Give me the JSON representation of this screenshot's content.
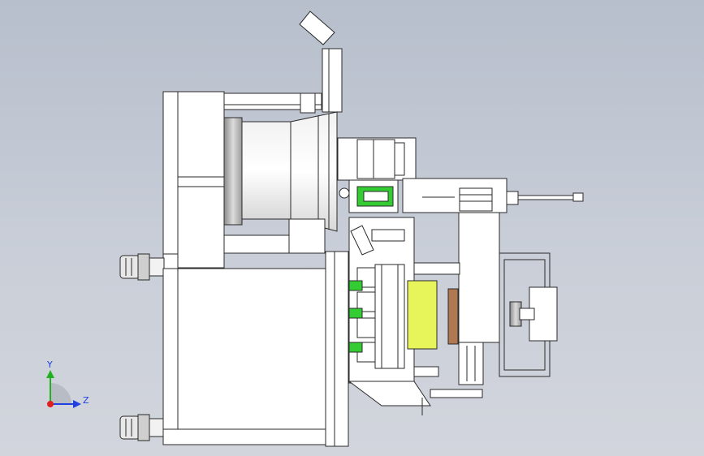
{
  "triad": {
    "y_label": "Y",
    "z_label": "Z",
    "x_color": "#e02020",
    "y_color": "#20b020",
    "z_color": "#2040e0"
  },
  "colors": {
    "background_top": "#b7bfcc",
    "background_bottom": "#d2d5dc",
    "part_fill": "#ffffff",
    "edge": "#2a2a2a",
    "highlight_green": "#33cc33",
    "highlight_yellow": "#e8f55a",
    "accent_brown": "#b07850"
  }
}
